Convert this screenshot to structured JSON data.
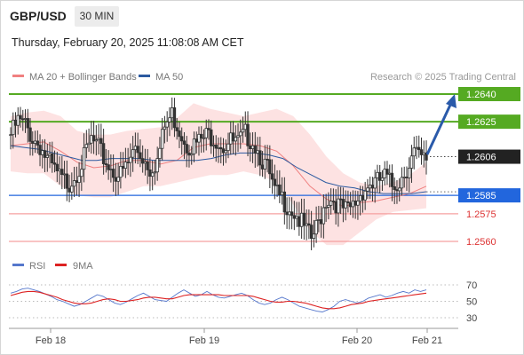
{
  "header": {
    "symbol": "GBP/USD",
    "timeframe": "30 MIN",
    "datetime": "Thursday, February 20, 2025 11:08:08 AM CET"
  },
  "legend": {
    "ma20_label": "MA 20 + Bollinger Bands",
    "ma50_label": "MA 50",
    "copyright": "Research © 2025 Trading Central",
    "rsi_label": "RSI",
    "rsi_ma_label": "9MA"
  },
  "colors": {
    "ma20": "#f08080",
    "ma50": "#2c5aa0",
    "bollinger_fill": "#fde0e0",
    "resistance": "#55aa22",
    "pivot": "#2266dd",
    "support": "#f5a0a0",
    "current": "#222222",
    "candle": "#333333",
    "arrow": "#2a5aaa",
    "rsi": "#5577cc",
    "rsi_ma": "#dd2222"
  },
  "chart_data": {
    "type": "candlestick",
    "title": "",
    "x_labels": [
      "Feb 18",
      "Feb 19",
      "Feb 20",
      "Feb 21"
    ],
    "ylim": [
      1.255,
      1.265
    ],
    "levels": [
      {
        "value": "1.2640",
        "kind": "resistance"
      },
      {
        "value": "1.2625",
        "kind": "resistance"
      },
      {
        "value": "1.2606",
        "kind": "current"
      },
      {
        "value": "1.2585",
        "kind": "pivot"
      },
      {
        "value": "1.2575",
        "kind": "support"
      },
      {
        "value": "1.2560",
        "kind": "support"
      }
    ],
    "close_path": [
      1.2618,
      1.2625,
      1.2623,
      1.2616,
      1.2612,
      1.2604,
      1.2598,
      1.2593,
      1.2592,
      1.2598,
      1.2605,
      1.2615,
      1.261,
      1.2603,
      1.2598,
      1.2596,
      1.2602,
      1.2611,
      1.2606,
      1.26,
      1.2604,
      1.2622,
      1.2629,
      1.2621,
      1.2613,
      1.2612,
      1.2615,
      1.2618,
      1.2616,
      1.2612,
      1.2614,
      1.2613,
      1.2618,
      1.2615,
      1.2607,
      1.2599,
      1.2586,
      1.2583,
      1.2579,
      1.2574,
      1.2567,
      1.2561,
      1.257,
      1.2583,
      1.2583,
      1.2578,
      1.2576,
      1.2581,
      1.2588,
      1.2591,
      1.2592,
      1.2595,
      1.259,
      1.2593,
      1.26,
      1.2608,
      1.2604
    ],
    "ma50": [
      1.2612,
      1.2611,
      1.261,
      1.2608,
      1.2606,
      1.2604,
      1.2604,
      1.2605,
      1.2605,
      1.2605,
      1.2604,
      1.2604,
      1.2604,
      1.2604,
      1.2605,
      1.2607,
      1.2608,
      1.2608,
      1.2607,
      1.2605,
      1.26,
      1.2596,
      1.2592,
      1.259,
      1.2589,
      1.2587,
      1.2586,
      1.2586,
      1.2586,
      1.2587
    ],
    "ma20": [
      1.2612,
      1.2613,
      1.2614,
      1.2609,
      1.2603,
      1.26,
      1.2601,
      1.2604,
      1.2604,
      1.2602,
      1.2604,
      1.2611,
      1.2613,
      1.2613,
      1.2613,
      1.2612,
      1.2609,
      1.2601,
      1.259,
      1.2583,
      1.2579,
      1.2581,
      1.2582,
      1.2584,
      1.2586,
      1.259
    ],
    "bollinger_upper": [
      1.2628,
      1.263,
      1.2631,
      1.2628,
      1.262,
      1.2618,
      1.2618,
      1.262,
      1.2621,
      1.2622,
      1.2627,
      1.2635,
      1.2632,
      1.263,
      1.2628,
      1.263,
      1.2632,
      1.2628,
      1.2618,
      1.2606,
      1.2597,
      1.2592,
      1.259,
      1.2592,
      1.2596,
      1.2603
    ],
    "bollinger_lower": [
      1.2598,
      1.2597,
      1.2597,
      1.259,
      1.2585,
      1.2584,
      1.2584,
      1.2587,
      1.259,
      1.259,
      1.2592,
      1.2594,
      1.2596,
      1.2596,
      1.2598,
      1.2596,
      1.2592,
      1.258,
      1.2566,
      1.2558,
      1.2558,
      1.2565,
      1.2572,
      1.2576,
      1.2577,
      1.2578
    ],
    "rsi_ticks": [
      "70",
      "50",
      "30"
    ],
    "rsi_ylim": [
      20,
      80
    ],
    "rsi": [
      60,
      62,
      65,
      66,
      64,
      62,
      59,
      56,
      52,
      50,
      47,
      44,
      46,
      50,
      54,
      58,
      56,
      52,
      48,
      46,
      49,
      53,
      57,
      60,
      56,
      52,
      51,
      50,
      55,
      60,
      64,
      60,
      56,
      58,
      62,
      58,
      55,
      54,
      56,
      58,
      60,
      57,
      52,
      48,
      46,
      48,
      52,
      55,
      52,
      48,
      44,
      42,
      40,
      38,
      37,
      40,
      44,
      50,
      52,
      50,
      48,
      50,
      54,
      56,
      58,
      55,
      57,
      60,
      62,
      60,
      64,
      62,
      64
    ],
    "rsi_ma": [
      57,
      59,
      61,
      62,
      62,
      61,
      59,
      57,
      55,
      52,
      50,
      48,
      47,
      47,
      48,
      50,
      52,
      53,
      52,
      50,
      50,
      51,
      52,
      54,
      55,
      55,
      54,
      53,
      53,
      55,
      57,
      58,
      58,
      58,
      58,
      58,
      58,
      57,
      57,
      57,
      57,
      57,
      56,
      54,
      52,
      50,
      49,
      49,
      50,
      50,
      49,
      48,
      46,
      44,
      42,
      41,
      41,
      42,
      44,
      46,
      47,
      48,
      50,
      51,
      52,
      53,
      54,
      55,
      56,
      57,
      58,
      59,
      60
    ]
  }
}
